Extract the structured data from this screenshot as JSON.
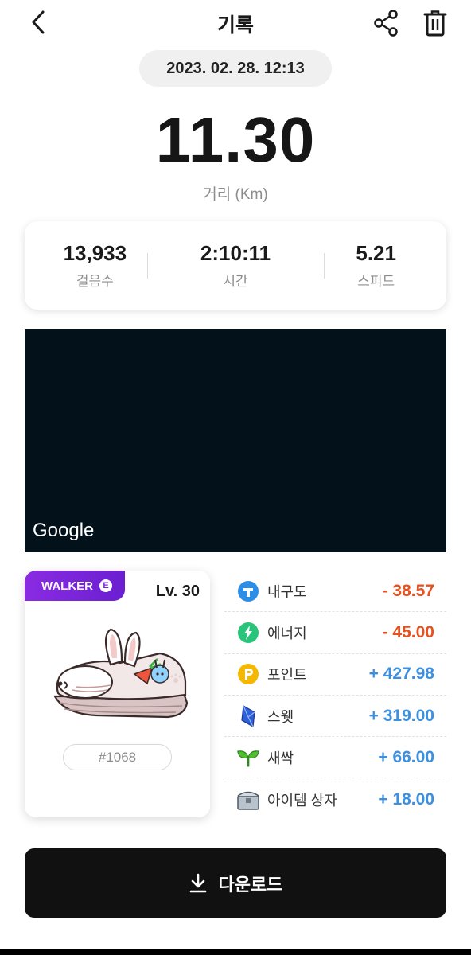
{
  "header": {
    "title": "기록",
    "back_icon": "chevron-left-icon",
    "share_icon": "share-icon",
    "delete_icon": "trash-icon"
  },
  "record": {
    "datetime": "2023. 02. 28. 12:13",
    "distance": "11.30",
    "distance_label": "거리 (Km)"
  },
  "stats": [
    {
      "value": "13,933",
      "label": "걸음수"
    },
    {
      "value": "2:10:11",
      "label": "시간"
    },
    {
      "value": "5.21",
      "label": "스피드"
    }
  ],
  "map": {
    "attribution": "Google"
  },
  "nft": {
    "grade": "WALKER",
    "grade_letter": "E",
    "level": "Lv. 30",
    "token_id": "#1068"
  },
  "rewards": [
    {
      "name": "내구도",
      "value": "- 38.57",
      "icon": "durability-icon",
      "color": "#2d8ee8"
    },
    {
      "name": "에너지",
      "value": "- 45.00",
      "icon": "energy-icon",
      "color": "#27c47a"
    },
    {
      "name": "포인트",
      "value": "+ 427.98",
      "icon": "point-icon",
      "color": "#f5b800"
    },
    {
      "name": "스웻",
      "value": "+ 319.00",
      "icon": "sweat-gem-icon",
      "color": "#2f5fd8"
    },
    {
      "name": "새싹",
      "value": "+ 66.00",
      "icon": "sprout-icon",
      "color": "#3fae2a"
    },
    {
      "name": "아이템 상자",
      "value": "+ 18.00",
      "icon": "item-box-icon",
      "color": "#7a8a9a"
    }
  ],
  "colors": {
    "negative": "#e8501e",
    "positive": "#3d8fe0",
    "grade_purple": "#8a2be2",
    "map_bg": "#02111a"
  },
  "download": {
    "label": "다운로드",
    "icon": "download-icon"
  }
}
